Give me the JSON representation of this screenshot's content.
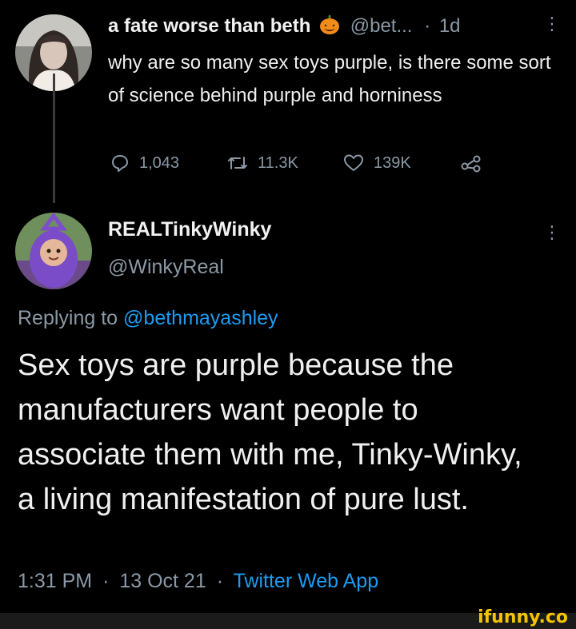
{
  "tweet1": {
    "display_name": "a fate worse than beth",
    "handle": "@bet...",
    "separator": "·",
    "age": "1d",
    "text": "why are so many sex toys purple, is there some sort of science behind purple and horniness",
    "stats": {
      "replies": "1,043",
      "retweets": "11.3K",
      "likes": "139K"
    },
    "name_emoji": "pumpkin-icon"
  },
  "tweet2": {
    "display_name": "REALTinkyWinky",
    "handle": "@WinkyReal",
    "replying_prefix": "Replying to",
    "replying_handle": "@bethmayashley",
    "text": "Sex toys are purple because the manufacturers want people to associate them with me, Tinky-Winky, a living manifestation of pure lust.",
    "time": "1:31 PM",
    "date": "13 Oct 21",
    "separator": "·",
    "source": "Twitter Web App"
  },
  "watermark": "ifunny.co",
  "colors": {
    "background": "#000000",
    "muted": "#8b98a5",
    "link": "#1d9bf0",
    "tinky_purple": "#6a3fb5",
    "pumpkin": "#f18b1a"
  }
}
